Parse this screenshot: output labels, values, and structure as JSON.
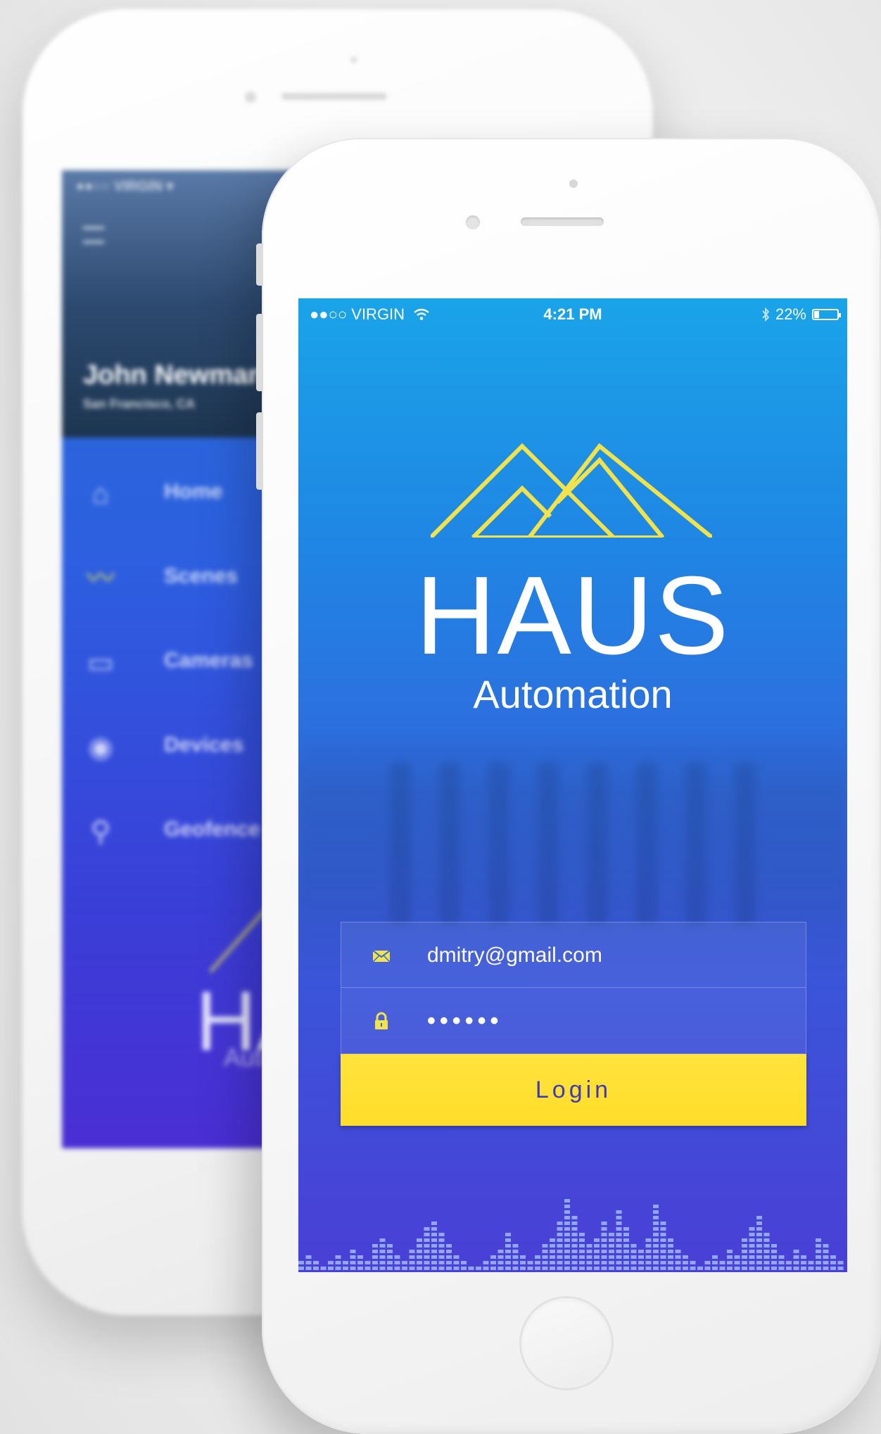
{
  "back_phone": {
    "status": "●●○○ VIRGIN ▾",
    "user_name": "John Newman",
    "user_location": "San Francisco, CA",
    "menu": [
      {
        "label": "Home",
        "icon": "home-icon"
      },
      {
        "label": "Scenes",
        "icon": "scenes-icon"
      },
      {
        "label": "Cameras",
        "icon": "camera-icon"
      },
      {
        "label": "Devices",
        "icon": "devices-icon"
      },
      {
        "label": "Geofence",
        "icon": "location-pin-icon"
      }
    ],
    "logo_word": "HAUS",
    "logo_sub": "Automation"
  },
  "status_bar": {
    "carrier": "●●○○ VIRGIN",
    "wifi_icon": "wifi-icon",
    "time": "4:21 PM",
    "bluetooth_icon": "bluetooth-icon",
    "battery": "22%",
    "battery_level": 0.22
  },
  "brand": {
    "name": "HAUS",
    "tagline": "Automation",
    "logo_color": "#f3e24a"
  },
  "login": {
    "email_icon": "envelope-icon",
    "email_value": "dmitry@gmail.com",
    "password_icon": "lock-icon",
    "password_value": "••••••",
    "button_label": "Login"
  },
  "colors": {
    "gradient_top": "#1aa4e8",
    "gradient_bottom": "#4a3fd6",
    "accent_yellow": "#ffdd2a",
    "button_text": "#3d3bb5"
  }
}
